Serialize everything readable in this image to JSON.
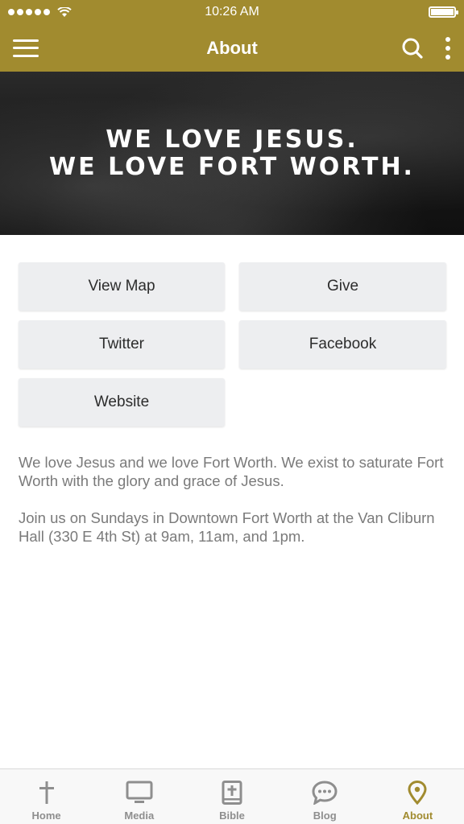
{
  "status_bar": {
    "time": "10:26 AM"
  },
  "nav": {
    "title": "About"
  },
  "hero": {
    "line1": "WE LOVE JESUS.",
    "line2": "WE LOVE FORT WORTH."
  },
  "buttons": [
    {
      "label": "View Map"
    },
    {
      "label": "Give"
    },
    {
      "label": "Twitter"
    },
    {
      "label": "Facebook"
    },
    {
      "label": "Website"
    }
  ],
  "description": {
    "paragraph1": "We love Jesus and we love Fort Worth. We exist to saturate Fort Worth with the glory and grace of Jesus.",
    "paragraph2": "Join us on Sundays in Downtown Fort Worth at the Van Cliburn Hall (330 E 4th St) at 9am, 11am, and 1pm."
  },
  "tabs": [
    {
      "label": "Home",
      "icon": "cross-icon"
    },
    {
      "label": "Media",
      "icon": "monitor-icon"
    },
    {
      "label": "Bible",
      "icon": "bible-icon"
    },
    {
      "label": "Blog",
      "icon": "chat-bubble-icon"
    },
    {
      "label": "About",
      "icon": "location-pin-icon",
      "active": true
    }
  ],
  "colors": {
    "brand": "#a18b2f",
    "tab_inactive": "#8e8e8e",
    "button_bg": "#edeef0",
    "body_text": "#7a7a7a"
  }
}
